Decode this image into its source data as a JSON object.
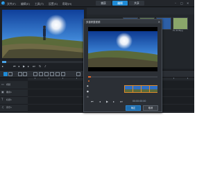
{
  "menubar": {
    "items": [
      "文件(F)",
      "编辑(E)",
      "工具(T)",
      "设置(S)",
      "帮助(H)"
    ],
    "modes": [
      "捕获",
      "编辑",
      "共享"
    ],
    "active_mode": "编辑"
  },
  "library": {
    "thumbs": [
      "",
      "",
      "",
      "",
      ""
    ],
    "labels": [
      "",
      "",
      "",
      "",
      "PL-4DBpg"
    ]
  },
  "timeline": {
    "tracks": [
      {
        "icon": "video-track-icon",
        "label": "视频"
      },
      {
        "icon": "overlay-track-icon",
        "label": "覆叠1"
      },
      {
        "icon": "title-track-icon",
        "label": "标题1"
      },
      {
        "icon": "music-track-icon",
        "label": "音乐1"
      }
    ]
  },
  "dialog": {
    "title": "多重修整视频",
    "timecode": "00:00:00:00",
    "ok_label": "确定",
    "cancel_label": "取消"
  },
  "colors": {
    "accent": "#1f8bd6",
    "marker": "#e08a2a"
  }
}
